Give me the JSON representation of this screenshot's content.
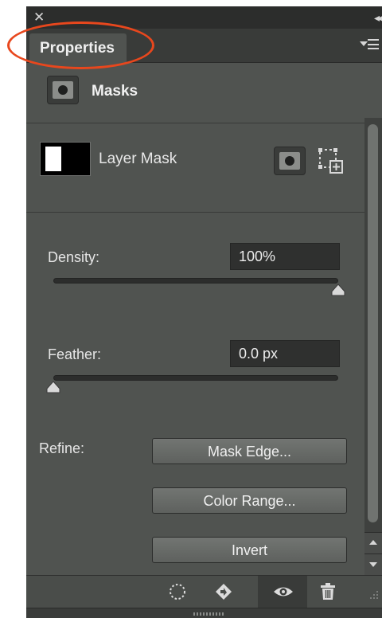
{
  "panel": {
    "tab_label": "Properties",
    "section_title": "Masks",
    "layer": {
      "label": "Layer Mask"
    },
    "density": {
      "label": "Density:",
      "value": "100%",
      "fraction": 1.0
    },
    "feather": {
      "label": "Feather:",
      "value": "0.0 px",
      "fraction": 0.0
    },
    "refine": {
      "label": "Refine:",
      "mask_edge": "Mask Edge...",
      "color_range": "Color Range...",
      "invert": "Invert"
    },
    "icons": {
      "close": "close-icon",
      "collapse": "collapse-double-arrow-icon",
      "panel_menu": "panel-menu-icon",
      "pixel_mask": "pixel-mask-icon",
      "vector_mask": "vector-mask-icon",
      "load_selection": "load-selection-icon",
      "apply_mask": "apply-mask-icon",
      "visibility": "eye-icon",
      "delete": "trash-icon"
    },
    "colors": {
      "highlight_ring": "#e8471d",
      "panel_bg": "#505350"
    }
  }
}
